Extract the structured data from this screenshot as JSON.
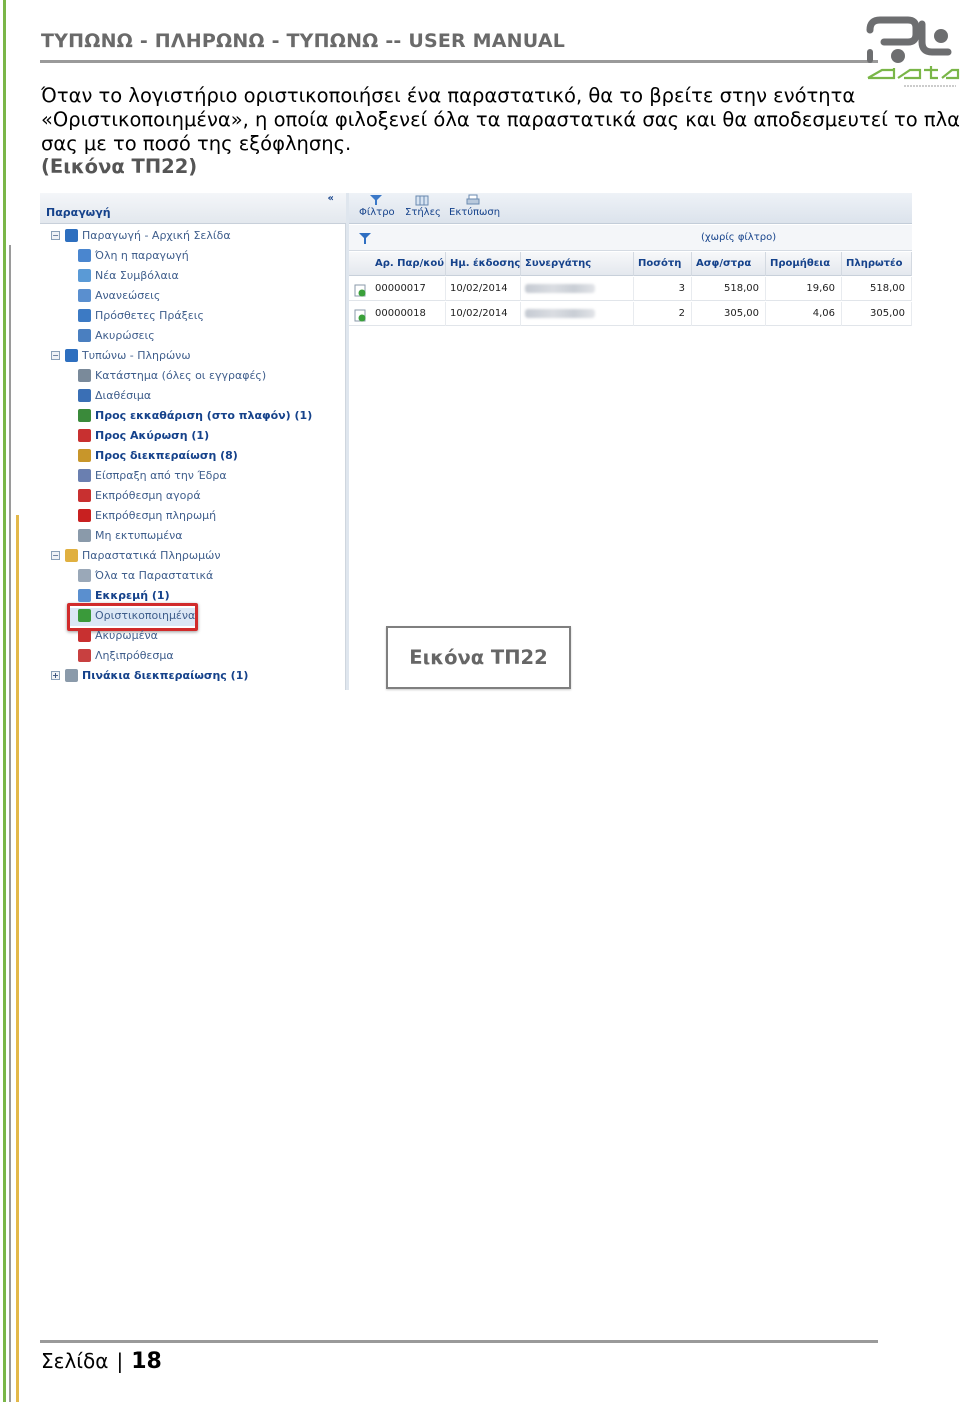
{
  "header": {
    "title": "ΤΥΠΩΝΩ - ΠΛΗΡΩΝΩ - ΤΥΠΩΝΩ -- USER MANUAL",
    "logo_text": "data software"
  },
  "intro": {
    "lines": [
      "Όταν το λογιστήριο οριστικοποιήσει ένα παραστατικό, θα το βρείτε στην ενότητα",
      "«Οριστικοποιημένα», η οποία φιλοξενεί όλα τα παραστατικά σας και θα αποδεσμευτεί το πλαφόν",
      "σας με το ποσό της εξόφλησης."
    ],
    "figure_ref": "(Εικόνα ΤΠ22)"
  },
  "screenshot": {
    "tree": {
      "header": "Παραγωγή",
      "items": [
        {
          "label": "Παραγωγή - Αρχική Σελίδα",
          "icon": "home-icon",
          "color": "#2e6fbf",
          "toggle": "−",
          "level": 0,
          "bold": false
        },
        {
          "label": "Όλη η παραγωγή",
          "icon": "database-icon",
          "color": "#4a86cf",
          "level": 1,
          "bold": false
        },
        {
          "label": "Νέα Συμβόλαια",
          "icon": "document-icon",
          "color": "#5a9ad6",
          "level": 1,
          "bold": false
        },
        {
          "label": "Ανανεώσεις",
          "icon": "renew-icon",
          "color": "#5a8fcf",
          "level": 1,
          "bold": false
        },
        {
          "label": "Πρόσθετες Πράξεις",
          "icon": "add-icon",
          "color": "#3c7ac4",
          "level": 1,
          "bold": false
        },
        {
          "label": "Ακυρώσεις",
          "icon": "cancel-icon",
          "color": "#4a7fc0",
          "level": 1,
          "bold": false
        },
        {
          "label": "Τυπώνω - Πληρώνω",
          "icon": "home-icon",
          "color": "#2e6fbf",
          "toggle": "−",
          "level": 0,
          "bold": false
        },
        {
          "label": "Κατάστημα (όλες οι εγγραφές)",
          "icon": "gears-icon",
          "color": "#7a8a9a",
          "level": 1,
          "bold": false
        },
        {
          "label": "Διαθέσιμα",
          "icon": "cart-icon",
          "color": "#3a6fb5",
          "level": 1,
          "bold": false
        },
        {
          "label": "Προς εκκαθάριση (στο πλαφόν) (1)",
          "icon": "cart-check-icon",
          "color": "#3a8a3a",
          "level": 1,
          "bold": true
        },
        {
          "label": "Προς Ακύρωση (1)",
          "icon": "cart-cancel-icon",
          "color": "#c83030",
          "level": 1,
          "bold": true
        },
        {
          "label": "Προς διεκπεραίωση (8)",
          "icon": "box-icon",
          "color": "#c8962a",
          "level": 1,
          "bold": true
        },
        {
          "label": "Είσπραξη από την Έδρα",
          "icon": "link-icon",
          "color": "#6a7fb0",
          "level": 1,
          "bold": false
        },
        {
          "label": "Εκπρόθεσμη αγορά",
          "icon": "cart-late-icon",
          "color": "#c83030",
          "level": 1,
          "bold": false
        },
        {
          "label": "Εκπρόθεσμη πληρωμή",
          "icon": "flag-icon",
          "color": "#c82020",
          "level": 1,
          "bold": false
        },
        {
          "label": "Μη εκτυπωμένα",
          "icon": "printer-icon",
          "color": "#8a9aaa",
          "level": 1,
          "bold": false
        },
        {
          "label": "Παραστατικά Πληρωμών",
          "icon": "folder-icon",
          "color": "#e0b040",
          "toggle": "−",
          "level": 0,
          "bold": false
        },
        {
          "label": "Όλα τα Παραστατικά",
          "icon": "page-icon",
          "color": "#9aa8b8",
          "level": 1,
          "bold": false
        },
        {
          "label": "Εκκρεμή (1)",
          "icon": "pending-icon",
          "color": "#5a8fcf",
          "level": 1,
          "bold": true
        },
        {
          "label": "Οριστικοποιημένα",
          "icon": "finalized-icon",
          "color": "#3a9a3a",
          "level": 1,
          "bold": false
        },
        {
          "label": "Ακυρωμένα",
          "icon": "cancelled-icon",
          "color": "#c83030",
          "level": 1,
          "bold": false
        },
        {
          "label": "Ληξιπρόθεσμα",
          "icon": "hourglass-icon",
          "color": "#c84040",
          "level": 1,
          "bold": false
        },
        {
          "label": "Πινάκια διεκπεραίωσης (1)",
          "icon": "list-icon",
          "color": "#8a9aaa",
          "toggle": "+",
          "level": 0,
          "bold": true
        }
      ]
    },
    "toolbar": {
      "filter": "Φίλτρο",
      "columns": "Στήλες",
      "print": "Εκτύπωση"
    },
    "filter_status": "(χωρίς φίλτρο)",
    "grid": {
      "columns": [
        "Αρ. Παρ/κού",
        "Ημ. έκδοσης",
        "Συνεργάτης",
        "Ποσότη",
        "Ασφ/στρα",
        "Προμήθεια",
        "Πληρωτέο"
      ],
      "rows": [
        [
          "00000017",
          "10/02/2014",
          "",
          "3",
          "518,00",
          "19,60",
          "518,00"
        ],
        [
          "00000018",
          "10/02/2014",
          "",
          "2",
          "305,00",
          "4,06",
          "305,00"
        ]
      ]
    }
  },
  "figure_label": "Εικόνα ΤΠ22",
  "footer": {
    "page_label": "Σελίδα",
    "separator": "|",
    "page_number": "18"
  },
  "colors": {
    "accent_green": "#7ab648",
    "accent_yellow": "#e3b84a",
    "rule_gray": "#9a9a9a",
    "highlight_red": "#d12b2b"
  }
}
